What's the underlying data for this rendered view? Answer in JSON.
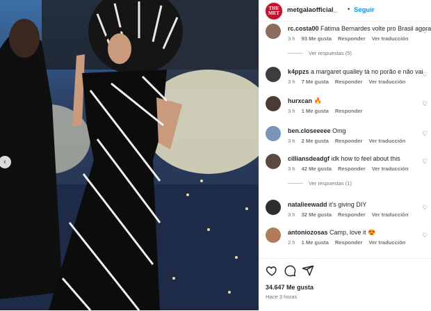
{
  "post": {
    "account": "metgalaofficial_",
    "separator": "•",
    "follow_label": "Seguir",
    "logo_text": [
      "THE",
      "MET"
    ],
    "likes": "34.647 Me gusta",
    "time_ago": "Hace 3 horas"
  },
  "labels": {
    "reply": "Responder",
    "translate": "Ver traducción"
  },
  "comments": [
    {
      "user": "rc.costa00",
      "text": "Fátima Bernardes volte pro Brasil agora",
      "time": "3 h",
      "likes": "93 Me gusta",
      "avatar_color": "#8a6d5a",
      "replies": "Ver respuestas (5)"
    },
    {
      "user": "k4ppzs",
      "text": "a margaret qualley tá no porão e não vai",
      "time": "3 h",
      "likes": "7 Me gusta",
      "avatar_color": "#3d3d3d"
    },
    {
      "user": "hurxcan",
      "text": "🔥",
      "time": "3 h",
      "likes": "1 Me gusta",
      "avatar_color": "#4a3b35"
    },
    {
      "user": "ben.closeeeee",
      "text": "Omg",
      "time": "3 h",
      "likes": "2 Me gusta",
      "avatar_color": "#7a95b8"
    },
    {
      "user": "cilliansdeadgf",
      "text": "idk how to feel about this",
      "time": "3 h",
      "likes": "42 Me gusta",
      "avatar_color": "#5c4a40",
      "replies": "Ver respuestas (1)"
    },
    {
      "user": "natalieewadd",
      "text": "it's giving DIY",
      "time": "3 h",
      "likes": "32 Me gusta",
      "avatar_color": "#2e2e2e"
    },
    {
      "user": "antoniozosas",
      "text": "Camp, love it 😍",
      "time": "2 h",
      "likes": "1 Me gusta",
      "avatar_color": "#b07c5a"
    }
  ],
  "icons": {
    "heart": "heart-icon",
    "comment": "comment-icon",
    "share": "share-icon",
    "prev": "chevron-left-icon"
  },
  "colors": {
    "follow": "#0095f6",
    "met_red": "#c8102e",
    "muted": "#737373"
  }
}
